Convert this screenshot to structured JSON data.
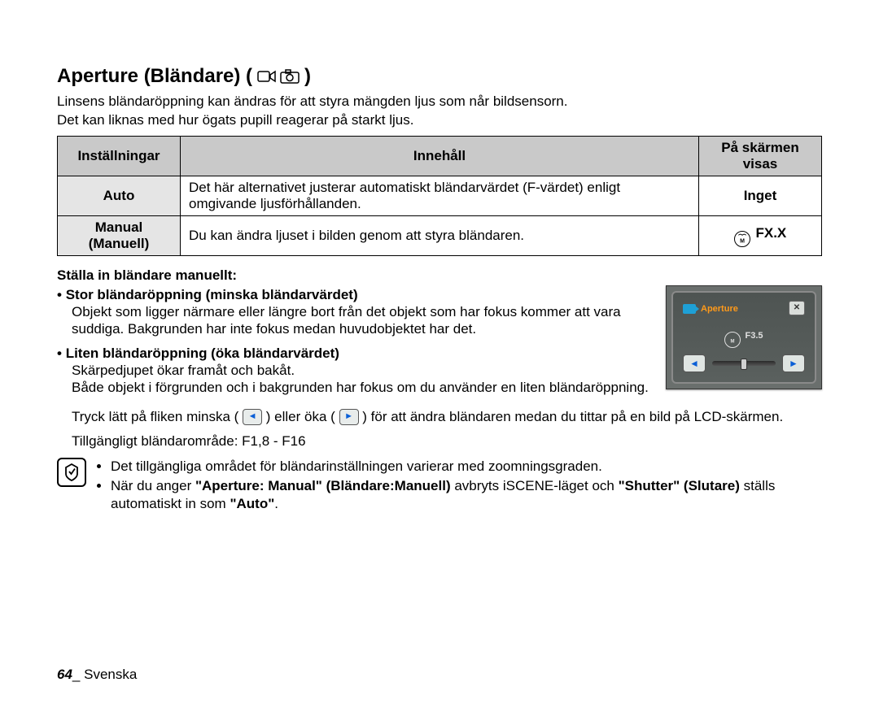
{
  "title": {
    "main": "Aperture (Bländare) (",
    "close": ")"
  },
  "intro": {
    "l1": "Linsens bländaröppning kan ändras för att styra mängden ljus som når bildsensorn.",
    "l2": "Det kan liknas med hur ögats pupill reagerar på starkt ljus."
  },
  "table": {
    "headers": {
      "settings": "Inställningar",
      "contents": "Innehåll",
      "display": "På skärmen visas"
    },
    "rows": [
      {
        "name": "Auto",
        "desc": "Det här alternativet justerar automatiskt bländarvärdet (F-värdet) enligt omgivande ljusförhållanden.",
        "display": "Inget",
        "hasIcon": false
      },
      {
        "name": "Manual\n(Manuell)",
        "desc": "Du kan ändra ljuset i bilden genom att styra bländaren.",
        "display": "FX.X",
        "hasIcon": true
      }
    ]
  },
  "manualSection": {
    "heading": "Ställa in bländare manuellt:",
    "items": [
      {
        "head": "Stor bländaröppning (minska bländarvärdet)",
        "body": "Objekt som ligger närmare eller längre bort från det objekt som har fokus kommer att vara suddiga. Bakgrunden har inte fokus medan huvudobjektet har det."
      },
      {
        "head": "Liten bländaröppning (öka bländarvärdet)",
        "body": "Skärpedjupet ökar framåt och bakåt.\nBåde objekt i förgrunden och i bakgrunden har fokus om du använder en liten bländaröppning."
      }
    ]
  },
  "lcd": {
    "title": "Aperture",
    "value": "F3.5"
  },
  "tapLine": {
    "pre": "Tryck lätt på fliken minska (",
    "mid": ") eller öka (",
    "post": ") för att ändra bländaren medan du tittar på en bild på LCD-skärmen."
  },
  "rangeLine": "Tillgängligt bländarområde: F1,8 - F16",
  "notes": {
    "n1": "Det tillgängliga området för bländarinställningen varierar med zoomningsgraden.",
    "n2_a": "När du anger ",
    "n2_b": "\"Aperture: Manual\" (Bländare:Manuell)",
    "n2_c": " avbryts iSCENE-läget och ",
    "n2_d": "\"Shutter\" (Slutare)",
    "n2_e": " ställs automatiskt in som ",
    "n2_f": "\"Auto\"",
    "n2_g": "."
  },
  "footer": {
    "page": "64",
    "sep": "_ ",
    "lang": "Svenska"
  }
}
